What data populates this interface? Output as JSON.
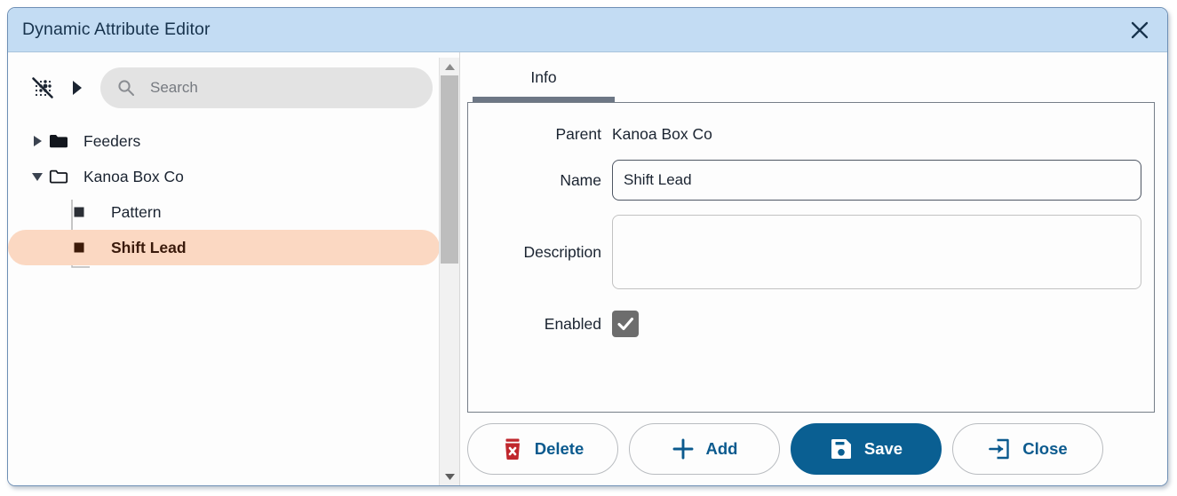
{
  "window": {
    "title": "Dynamic Attribute Editor",
    "close_icon": "close-icon",
    "titlebar_color": "#c3dcf3",
    "border_color": "#6e8fb5"
  },
  "left_pane": {
    "toolbar": {
      "grid_toggle_icon": "dotted-grid-slash-icon",
      "expand_arrow_icon": "chevron-right-icon"
    },
    "search": {
      "placeholder": "Search",
      "value": "",
      "icon": "search-icon"
    },
    "tree": {
      "nodes": [
        {
          "label": "Feeders",
          "icon": "folder-closed-icon",
          "twisty": "collapsed",
          "depth": 0,
          "selected": false
        },
        {
          "label": "Kanoa Box Co",
          "icon": "folder-open-icon",
          "twisty": "expanded",
          "depth": 0,
          "selected": false
        },
        {
          "label": "Pattern",
          "icon": "square-node-icon",
          "twisty": "none",
          "depth": 1,
          "selected": false
        },
        {
          "label": "Shift Lead",
          "icon": "square-node-icon",
          "twisty": "none",
          "depth": 1,
          "selected": true
        }
      ],
      "selection_color": "#fbd8c2"
    },
    "scrollbar": {
      "up_icon": "triangle-up-icon",
      "down_icon": "triangle-down-icon",
      "thumb_color": "#bdbdbd"
    }
  },
  "right_pane": {
    "tabs": [
      {
        "label": "Info",
        "active": true
      }
    ],
    "active_tab_color": "#6d7785",
    "form": {
      "parent_label": "Parent",
      "parent_value": "Kanoa Box Co",
      "name_label": "Name",
      "name_value": "Shift Lead",
      "name_placeholder": "",
      "description_label": "Description",
      "description_value": "",
      "description_placeholder": "",
      "enabled_label": "Enabled",
      "enabled_checked": true,
      "check_icon": "checkmark-icon"
    },
    "buttons": [
      {
        "label": "Delete",
        "icon": "trash-x-icon",
        "style": "secondary",
        "accent": "#c0272d"
      },
      {
        "label": "Add",
        "icon": "plus-icon",
        "style": "secondary",
        "accent": "#0b5a8e"
      },
      {
        "label": "Save",
        "icon": "floppy-disk-icon",
        "style": "primary",
        "accent": "#0a5f92"
      },
      {
        "label": "Close",
        "icon": "exit-arrow-icon",
        "style": "secondary",
        "accent": "#0b5a8e"
      }
    ]
  }
}
